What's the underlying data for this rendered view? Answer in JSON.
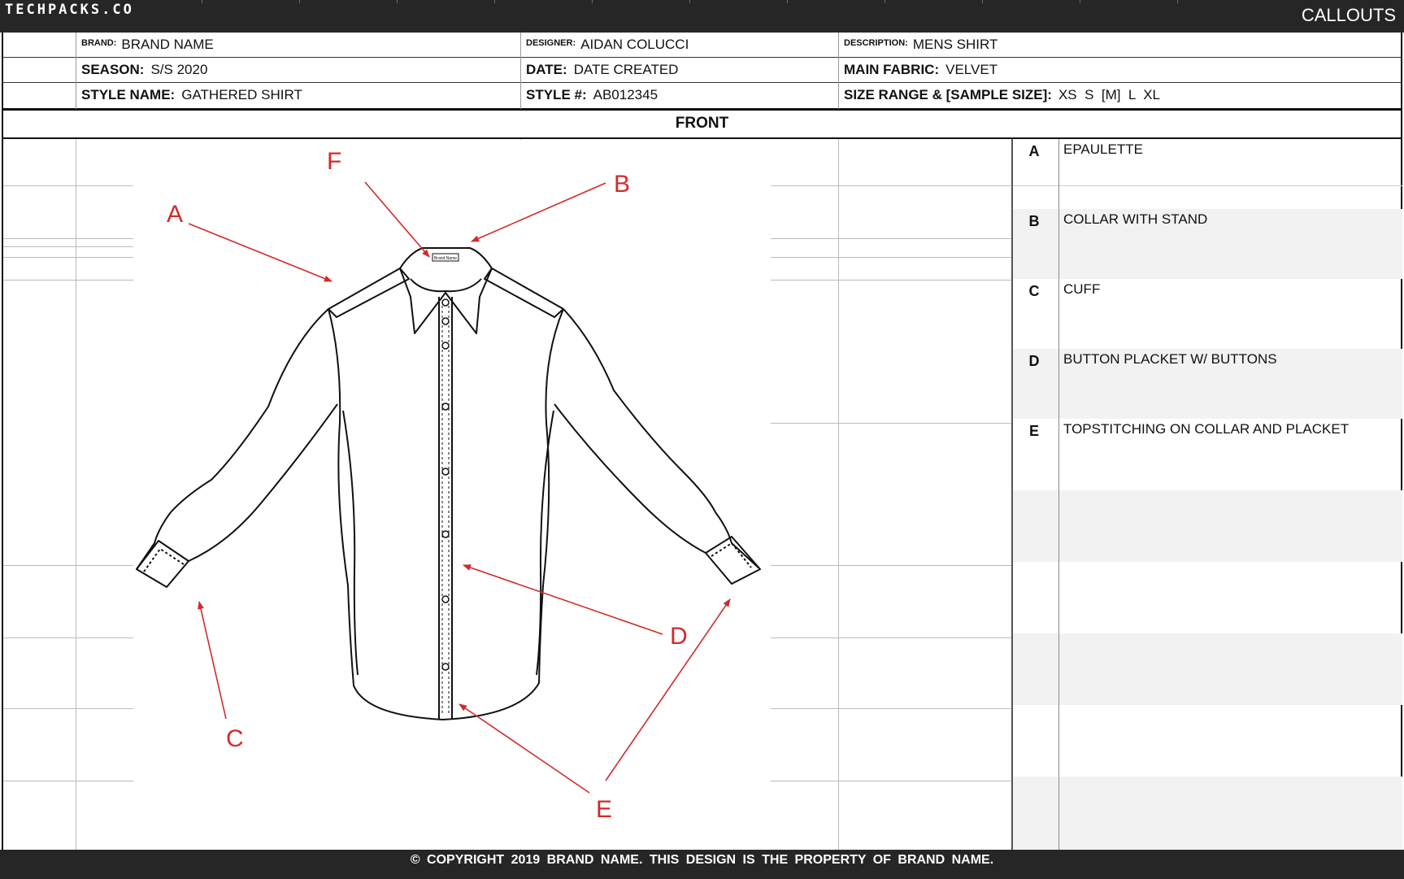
{
  "header": {
    "logo": "TECHPACKS.CO",
    "sheet_title": "CALLOUTS"
  },
  "info": {
    "brand_label": "BRAND:",
    "brand": "BRAND NAME",
    "designer_label": "DESIGNER:",
    "designer": "AIDAN COLUCCI",
    "description_label": "DESCRIPTION:",
    "description": "MENS SHIRT",
    "season_label": "SEASON:",
    "season": "S/S 2020",
    "date_label": "DATE:",
    "date": "DATE CREATED",
    "main_fabric_label": "MAIN FABRIC:",
    "main_fabric": "VELVET",
    "style_name_label": "STYLE NAME:",
    "style_name": "GATHERED SHIRT",
    "style_no_label": "STYLE #:",
    "style_no": "AB012345",
    "size_range_label": "SIZE RANGE & [SAMPLE SIZE]:",
    "size_range": "XS  S  [M]  L  XL"
  },
  "view_title": "FRONT",
  "drawing": {
    "neck_label": "Brand Name",
    "labels": [
      "A",
      "B",
      "C",
      "D",
      "E",
      "F"
    ],
    "label_color": "#d22a2a"
  },
  "callouts": [
    {
      "letter": "A",
      "text": "EPAULETTE"
    },
    {
      "letter": "B",
      "text": "COLLAR WITH STAND"
    },
    {
      "letter": "C",
      "text": "CUFF"
    },
    {
      "letter": "D",
      "text": "BUTTON PLACKET W/ BUTTONS"
    },
    {
      "letter": "E",
      "text": "TOPSTITCHING ON COLLAR AND PLACKET"
    }
  ],
  "footer": "© COPYRIGHT 2019 BRAND NAME.  THIS DESIGN IS THE PROPERTY OF BRAND NAME."
}
